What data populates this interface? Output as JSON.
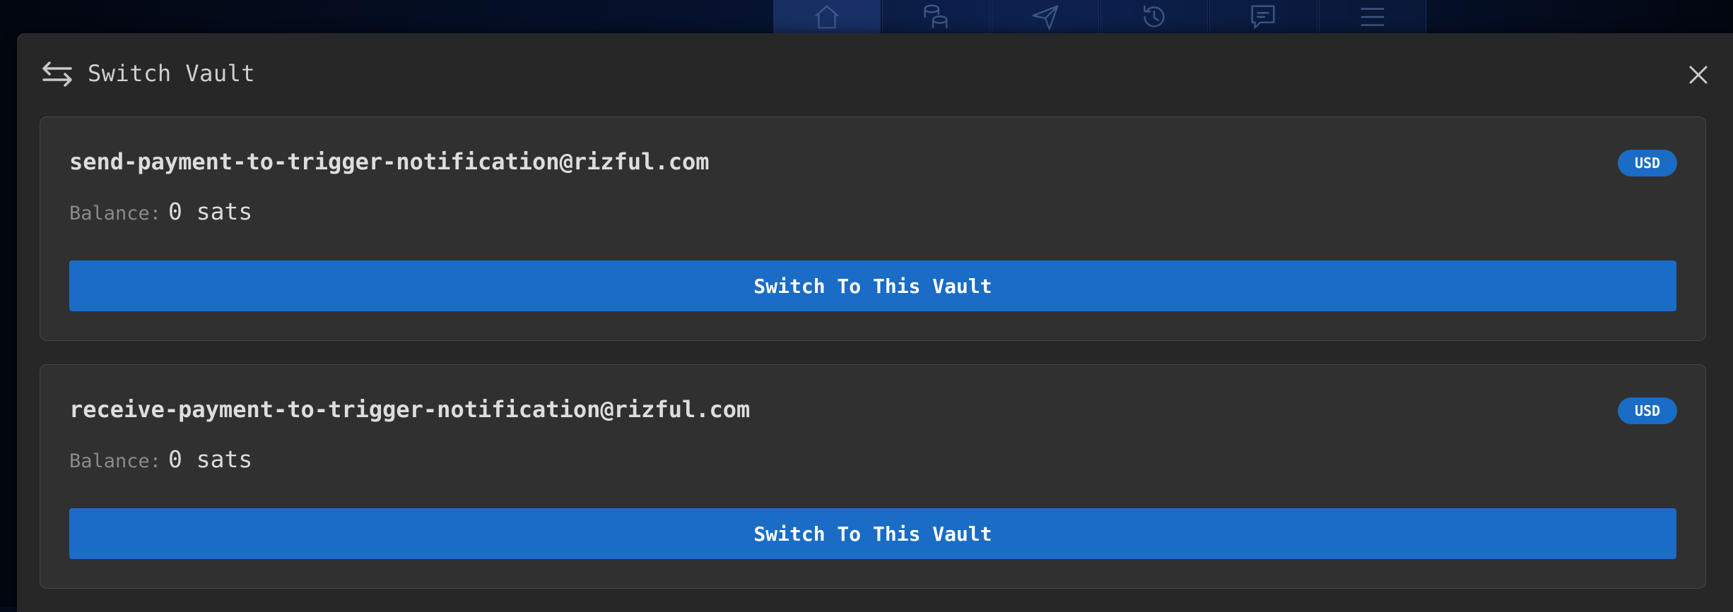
{
  "modal": {
    "title": "Switch Vault",
    "title_icon": "switch-arrows-icon",
    "close_icon": "close-icon"
  },
  "background_nav": {
    "icons": [
      "home-icon",
      "coins-icon",
      "send-icon",
      "history-icon",
      "message-icon",
      "menu-icon"
    ],
    "active_index": 0
  },
  "vaults": [
    {
      "address": "send-payment-to-trigger-notification@rizful.com",
      "currency": "USD",
      "balance_label": "Balance:",
      "balance_value": "0 sats",
      "button_label": "Switch To This Vault"
    },
    {
      "address": "receive-payment-to-trigger-notification@rizful.com",
      "currency": "USD",
      "balance_label": "Balance:",
      "balance_value": "0 sats",
      "button_label": "Switch To This Vault"
    }
  ],
  "colors": {
    "accent": "#1a6cc4",
    "modal_bg": "#272727",
    "card_bg": "#303030"
  }
}
